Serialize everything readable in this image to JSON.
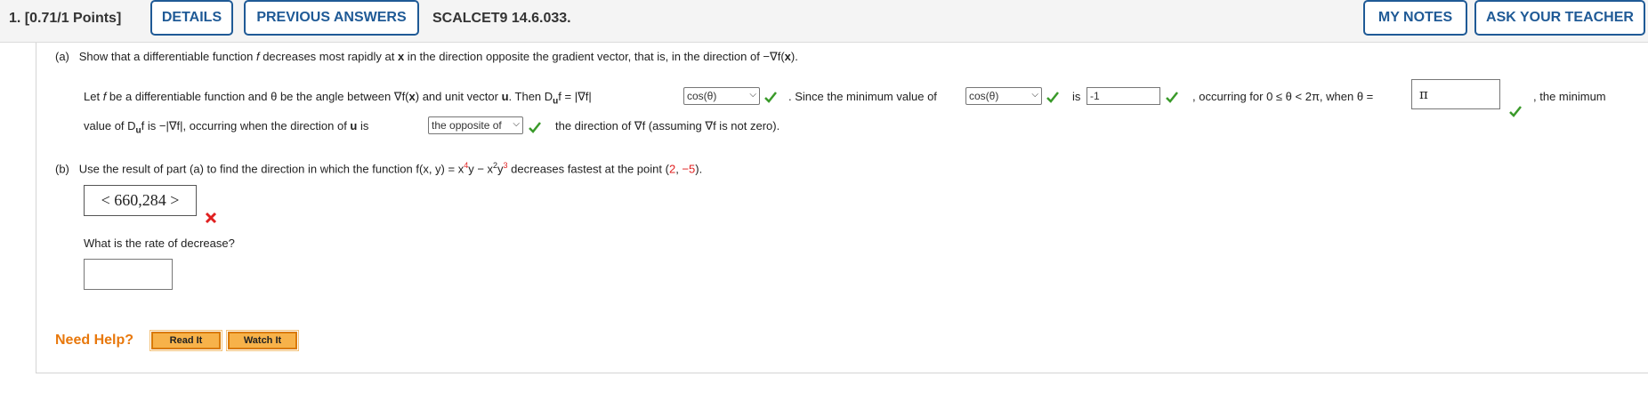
{
  "header": {
    "question_number": "1.",
    "points": "[0.71/1 Points]",
    "details_label": "DETAILS",
    "previous_answers_label": "PREVIOUS ANSWERS",
    "question_code": "SCALCET9 14.6.033.",
    "my_notes_label": "MY NOTES",
    "ask_teacher_label": "ASK YOUR TEACHER"
  },
  "part_a": {
    "label": "(a)",
    "prompt_1": "Show that a differentiable function ",
    "prompt_f": "f",
    "prompt_2": " decreases most rapidly at ",
    "prompt_x": "x",
    "prompt_3": " in the direction opposite the gradient vector, that is, in the direction of −∇f(",
    "prompt_x2": "x",
    "prompt_4": ").",
    "line1_a": "Let ",
    "line1_b": " be a differentiable function and θ be the angle between ∇f(",
    "line1_c": ") and unit vector ",
    "line1_u": "u",
    "line1_d": ". Then D",
    "line1_e": "f = |∇f|",
    "select1_value": "cos(θ)",
    "line1_since": ". Since the minimum value of",
    "select2_value": "cos(θ)",
    "line1_is": "is",
    "input1_value": "-1",
    "line1_occurring": ", occurring for 0 ≤ θ < 2π, when θ =",
    "theta_answer": "π",
    "line1_end": ", the minimum",
    "line2_a": "value of D",
    "line2_b": "f is −|∇f|, occurring when the direction of ",
    "line2_c": " is",
    "select3_value": "the opposite of",
    "line2_d": "the direction of ∇f (assuming ∇f is not zero)."
  },
  "part_b": {
    "label": "(b)",
    "prompt_1": "Use the result of part (a) to find the direction in which the function f(x, y) = x",
    "exp1": "4",
    "prompt_2": "y − x",
    "exp2": "2",
    "prompt_3": "y",
    "exp3": "3",
    "prompt_4": " decreases fastest at the point (",
    "point_x": "2",
    "comma": ", ",
    "point_y": "−5",
    "prompt_5": ").",
    "answer": "< 660,284 >",
    "rate_question": "What is the rate of decrease?",
    "rate_value": ""
  },
  "help": {
    "label": "Need Help?",
    "read_it": "Read It",
    "watch_it": "Watch It"
  },
  "colors": {
    "accent_blue": "#1f5a96",
    "correct_green": "#3a9a2a",
    "wrong_red": "#e02020",
    "help_orange": "#e8780c"
  }
}
